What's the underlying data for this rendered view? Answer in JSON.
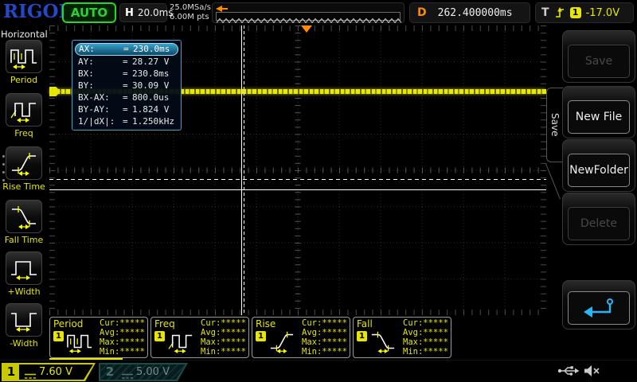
{
  "topbar": {
    "logo": "RIGOL",
    "run_state": "AUTO",
    "h_label": "H",
    "h_value": "20.0ms",
    "sample_rate": "25.0MSa/s",
    "mem_depth": "6.00M pts",
    "d_label": "D",
    "d_value": "262.400000ms",
    "t_label": "T",
    "t_channel": "1",
    "t_value": "-17.0V"
  },
  "sidebar": {
    "title": "Horizontal",
    "items": [
      {
        "label": "Period",
        "icon": "period-icon"
      },
      {
        "label": "Freq",
        "icon": "freq-icon"
      },
      {
        "label": "Rise Time",
        "icon": "rise-icon"
      },
      {
        "label": "Fall Time",
        "icon": "fall-icon"
      },
      {
        "label": "+Width",
        "icon": "pwidth-icon"
      },
      {
        "label": "-Width",
        "icon": "nwidth-icon"
      }
    ]
  },
  "cursor_box": {
    "rows": [
      {
        "label": "AX:",
        "eq": "=",
        "value": "230.0ms",
        "highlight": true
      },
      {
        "label": "AY:",
        "eq": "=",
        "value": "28.27 V",
        "highlight": false
      },
      {
        "label": "BX:",
        "eq": "=",
        "value": "230.8ms",
        "highlight": false
      },
      {
        "label": "BY:",
        "eq": "=",
        "value": "30.09 V",
        "highlight": false
      },
      {
        "label": "BX-AX:",
        "eq": "=",
        "value": "800.0us",
        "highlight": false
      },
      {
        "label": "BY-AY:",
        "eq": "=",
        "value": "1.824 V",
        "highlight": false
      },
      {
        "label": "1/|dX|:",
        "eq": "=",
        "value": "1.250kHz",
        "highlight": false
      }
    ]
  },
  "menu": {
    "tab": "Save",
    "items": [
      {
        "label": "Save",
        "enabled": false
      },
      {
        "label": "New File",
        "enabled": true
      },
      {
        "label": "NewFolder",
        "enabled": true
      },
      {
        "label": "Delete",
        "enabled": false
      }
    ],
    "back_icon": "return-arrow-icon"
  },
  "measurements": {
    "stat_labels": [
      "Cur:",
      "Avg:",
      "Max:",
      "Min:"
    ],
    "panels": [
      {
        "name": "Period",
        "channel": "1",
        "icon": "period-icon",
        "cur": "*****",
        "avg": "*****",
        "max": "*****",
        "min": "*****"
      },
      {
        "name": "Freq",
        "channel": "1",
        "icon": "freq-icon",
        "cur": "*****",
        "avg": "*****",
        "max": "*****",
        "min": "*****"
      },
      {
        "name": "Rise",
        "channel": "1",
        "icon": "rise-icon",
        "cur": "*****",
        "avg": "*****",
        "max": "*****",
        "min": "*****"
      },
      {
        "name": "Fall",
        "channel": "1",
        "icon": "fall-icon",
        "cur": "*****",
        "avg": "*****",
        "max": "*****",
        "min": "*****"
      }
    ]
  },
  "channels": [
    {
      "id": "1",
      "value": "7.60 V",
      "coupling": "dc-coupling-icon",
      "active": true
    },
    {
      "id": "2",
      "value": "5.00 V",
      "coupling": "dc-coupling-icon",
      "active": false
    }
  ],
  "status_icons": [
    "usb-icon",
    "speaker-mute-icon"
  ],
  "colors": {
    "waveform_yellow": "#e8e800",
    "trigger_orange": "#ff8c00",
    "cursor_border_blue": "#4a9cc9",
    "run_green": "#2bd42b",
    "logo_blue": "#2149c8",
    "menu_arrow_cyan": "#29b6f6"
  }
}
